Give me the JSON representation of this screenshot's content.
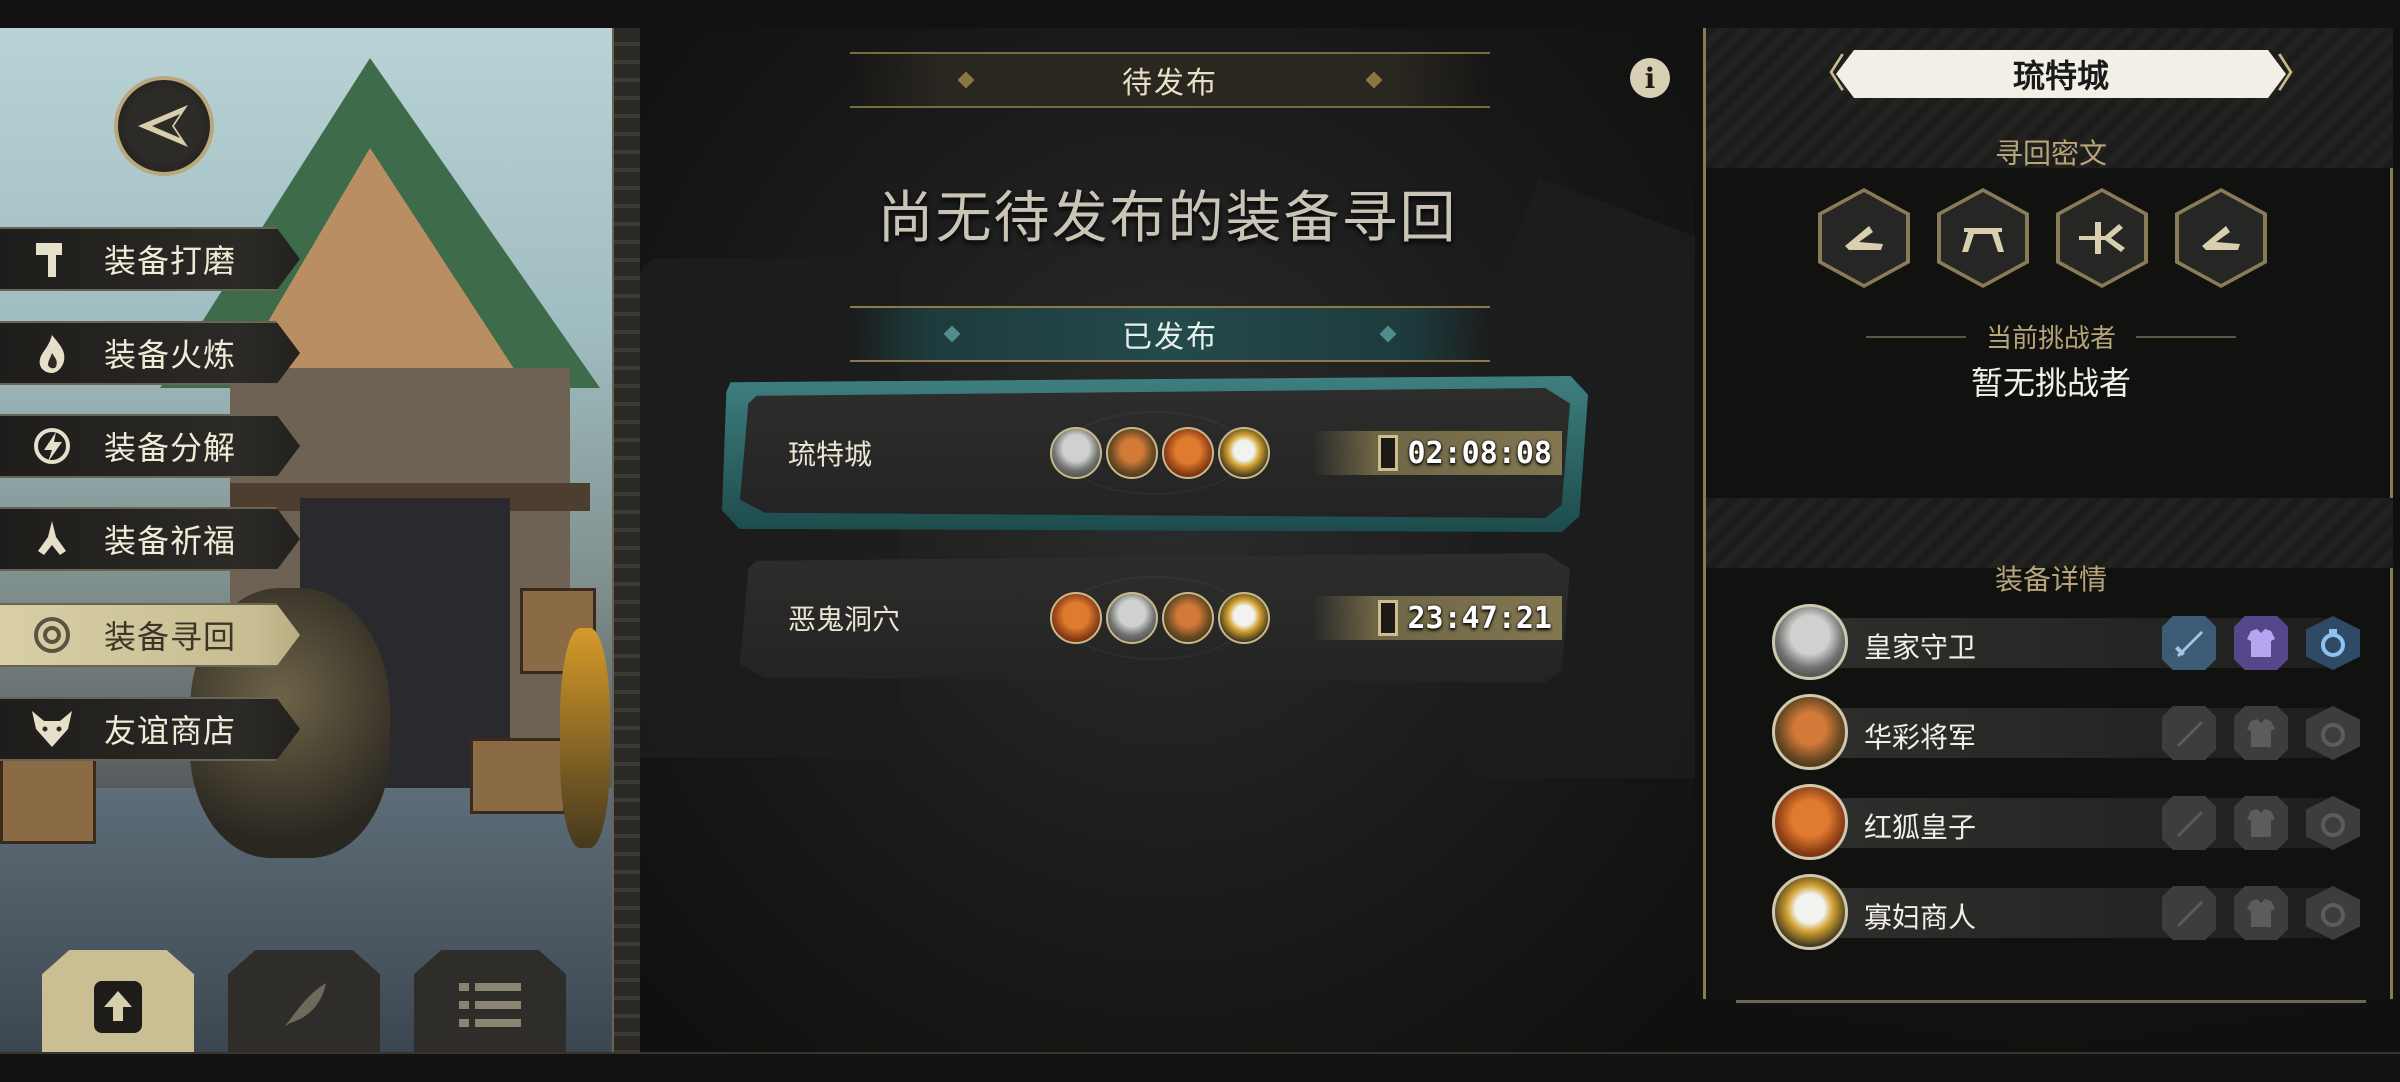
{
  "menu": {
    "items": [
      {
        "label": "装备打磨",
        "icon": "hammer-icon",
        "active": false
      },
      {
        "label": "装备火炼",
        "icon": "flame-icon",
        "active": false
      },
      {
        "label": "装备分解",
        "icon": "disassemble-icon",
        "active": false
      },
      {
        "label": "装备祈福",
        "icon": "pray-hands-icon",
        "active": false
      },
      {
        "label": "装备寻回",
        "icon": "target-icon",
        "active": true
      },
      {
        "label": "友谊商店",
        "icon": "fox-head-icon",
        "active": false
      }
    ],
    "bottom_buttons": [
      {
        "icon": "upload-file-icon",
        "active": true
      },
      {
        "icon": "feather-icon",
        "active": false
      },
      {
        "icon": "list-icon",
        "active": false
      }
    ]
  },
  "center": {
    "pending_title": "待发布",
    "empty_message": "尚无待发布的装备寻回",
    "published_title": "已发布",
    "quests": [
      {
        "name": "琉特城",
        "timer": "02:08:08",
        "selected": true,
        "portraits": [
          "gray-knight",
          "lion-general",
          "red-fox",
          "widow-merchant"
        ]
      },
      {
        "name": "恶鬼洞穴",
        "timer": "23:47:21",
        "selected": false,
        "portraits": [
          "red-fox",
          "gray-knight",
          "lion-general",
          "widow-merchant"
        ]
      }
    ]
  },
  "right": {
    "city_title": "琉特城",
    "runes_title": "寻回密文",
    "runes": [
      "rune-hand-icon",
      "rune-arch-icon",
      "rune-cross-icon",
      "rune-hand-icon"
    ],
    "challenger_label": "当前挑战者",
    "challenger_value": "暂无挑战者",
    "detail_title": "装备详情",
    "heroes": [
      {
        "name": "皇家守卫",
        "avatar": "gray-knight",
        "slots_filled": [
          true,
          true,
          true
        ]
      },
      {
        "name": "华彩将军",
        "avatar": "lion-general",
        "slots_filled": [
          false,
          false,
          false
        ]
      },
      {
        "name": "红狐皇子",
        "avatar": "red-fox",
        "slots_filled": [
          false,
          false,
          false
        ]
      },
      {
        "name": "寡妇商人",
        "avatar": "widow-merchant",
        "slots_filled": [
          false,
          false,
          false
        ]
      }
    ]
  },
  "colors": {
    "accent_gold": "#c9b98a",
    "teal_selected": "#3f7f80",
    "weapon_filled": "#3d5b74",
    "armor_filled": "#56468a"
  }
}
